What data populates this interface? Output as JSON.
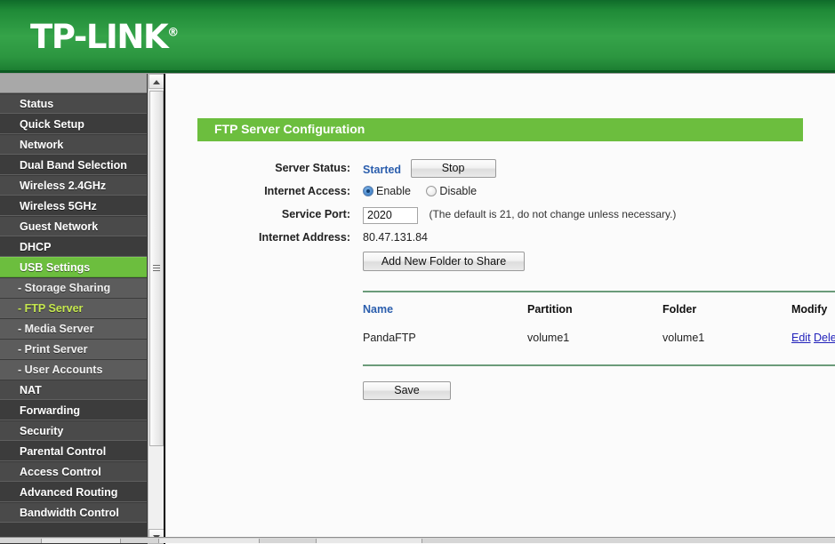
{
  "brand": {
    "name": "TP-LINK",
    "registered_mark": "®"
  },
  "sidebar": {
    "items": [
      {
        "label": "Status",
        "type": "top",
        "state": "normal"
      },
      {
        "label": "Quick Setup",
        "type": "top",
        "state": "normal"
      },
      {
        "label": "Network",
        "type": "top",
        "state": "normal"
      },
      {
        "label": "Dual Band Selection",
        "type": "top",
        "state": "normal"
      },
      {
        "label": "Wireless 2.4GHz",
        "type": "top",
        "state": "normal"
      },
      {
        "label": "Wireless 5GHz",
        "type": "top",
        "state": "normal"
      },
      {
        "label": "Guest Network",
        "type": "top",
        "state": "normal"
      },
      {
        "label": "DHCP",
        "type": "top",
        "state": "normal"
      },
      {
        "label": "USB Settings",
        "type": "top",
        "state": "active"
      },
      {
        "label": "- Storage Sharing",
        "type": "sub",
        "state": "normal"
      },
      {
        "label": "- FTP Server",
        "type": "sub",
        "state": "active"
      },
      {
        "label": "- Media Server",
        "type": "sub",
        "state": "normal"
      },
      {
        "label": "- Print Server",
        "type": "sub",
        "state": "normal"
      },
      {
        "label": "- User Accounts",
        "type": "sub",
        "state": "normal"
      },
      {
        "label": "NAT",
        "type": "top",
        "state": "normal"
      },
      {
        "label": "Forwarding",
        "type": "top",
        "state": "normal"
      },
      {
        "label": "Security",
        "type": "top",
        "state": "normal"
      },
      {
        "label": "Parental Control",
        "type": "top",
        "state": "normal"
      },
      {
        "label": "Access Control",
        "type": "top",
        "state": "normal"
      },
      {
        "label": "Advanced Routing",
        "type": "top",
        "state": "normal"
      },
      {
        "label": "Bandwidth Control",
        "type": "top",
        "state": "normal"
      }
    ],
    "scrollbar": {
      "up_icon": "triangle-up-icon",
      "down_icon": "triangle-down-icon",
      "grip_icon": "grip-lines-icon"
    }
  },
  "main": {
    "section_title": "FTP Server Configuration",
    "fields": {
      "server_status_label": "Server Status:",
      "server_status_value": "Started",
      "stop_button_label": "Stop",
      "internet_access_label": "Internet Access:",
      "enable_label": "Enable",
      "disable_label": "Disable",
      "internet_access_selected": "Enable",
      "service_port_label": "Service Port:",
      "service_port_value": "2020",
      "service_port_hint": "(The default is 21, do not change unless necessary.)",
      "internet_address_label": "Internet Address:",
      "internet_address_value": "80.47.131.84"
    },
    "add_folder_button_label": "Add New Folder to Share",
    "table": {
      "headers": [
        "Name",
        "Partition",
        "Folder",
        "Modify"
      ],
      "rows": [
        {
          "name": "PandaFTP",
          "partition": "volume1",
          "folder": "volume1",
          "edit_label": "Edit",
          "delete_label": "Delete"
        }
      ]
    },
    "save_button_label": "Save"
  },
  "colors": {
    "brand_green": "#35a349",
    "accent_green": "#6cbe3e",
    "active_sub_text": "#c6e84f",
    "link_blue": "#2222bb",
    "status_blue": "#2b5ead",
    "divider_green": "#6b9b7a"
  }
}
